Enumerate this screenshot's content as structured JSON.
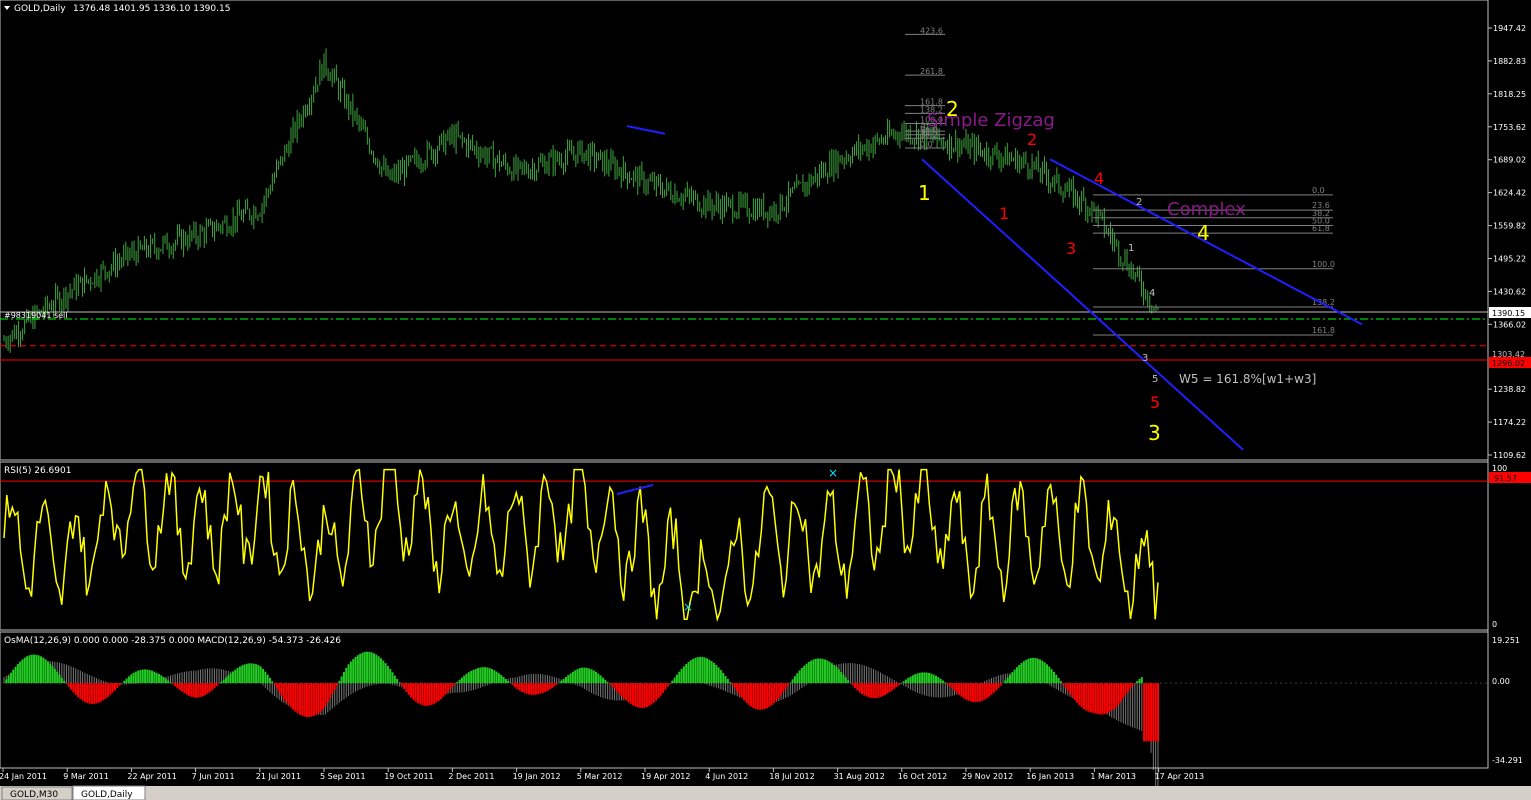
{
  "symbol_header": {
    "title": "GOLD,Daily",
    "ohlc": "1376.48 1401.95 1336.10 1390.15"
  },
  "tabs": [
    {
      "label": "GOLD,M30",
      "active": false
    },
    {
      "label": "GOLD,Daily",
      "active": true
    }
  ],
  "colors": {
    "background": "#000000",
    "price_bars": "#3fa63f",
    "rsi_line": "#ffff00",
    "osma_pos": "#22cc22",
    "osma_neg": "#ff0000",
    "macd_line": "#c8c8c8",
    "trendline": "#1f1fff",
    "fib_lines": "#808080",
    "wave_yellow": "#ffff00",
    "wave_red": "#ff0000",
    "wave_purple": "#8b1a8b"
  },
  "price_panel": {
    "y_ticks": [
      "1947.42",
      "1882.83",
      "1818.25",
      "1753.62",
      "1689.02",
      "1624.42",
      "1559.82",
      "1495.22",
      "1430.62",
      "1366.02",
      "1301.42",
      "1238.82",
      "1174.22",
      "1109.62"
    ],
    "current_price_label": "1390.15",
    "stop_level_label": "1296.02",
    "stop_level_partial_label": "1303.42",
    "order_label": "#98319041 sell"
  },
  "rsi_panel": {
    "label": "RSI(5) 26.6901",
    "y_ticks": [
      "100",
      "0"
    ],
    "level_label": "91.57"
  },
  "macd_panel": {
    "label": "OsMA(12,26,9) 0.000 0.000 -28.375 0.000  MACD(12,26,9) -54.373 -26.426",
    "y_ticks": [
      "19.251",
      "0.00",
      "-34.291"
    ]
  },
  "x_axis_labels": [
    "24 Jan 2011",
    "9 Mar 2011",
    "22 Apr 2011",
    "7 Jun 2011",
    "21 Jul 2011",
    "5 Sep 2011",
    "19 Oct 2011",
    "2 Dec 2011",
    "19 Jan 2012",
    "5 Mar 2012",
    "19 Apr 2012",
    "4 Jun 2012",
    "18 Jul 2012",
    "31 Aug 2012",
    "16 Oct 2012",
    "29 Nov 2012",
    "16 Jan 2013",
    "1 Mar 2013",
    "17 Apr 2013"
  ],
  "fib_small": [
    "423.6",
    "261.8",
    "161.8",
    "138.2",
    "100.0",
    "61.8",
    "50.0",
    "38.2",
    "0.0"
  ],
  "fib_large": [
    "0.0",
    "23.6",
    "38.2",
    "50.0",
    "61.8",
    "100.0",
    "138.2",
    "161.8"
  ],
  "wave_labels": {
    "y1": "1",
    "y2": "2",
    "y3": "3",
    "y4": "4",
    "r1": "1",
    "r2": "2",
    "r3": "3",
    "r4": "4",
    "r5": "5",
    "g1": "1",
    "g2": "2",
    "g3": "3",
    "g4": "4",
    "g5": "5",
    "simple_zigzag": "Simple Zigzag",
    "complex": "Complex",
    "w5_note": "W5 = 161.8%[w1+w3]"
  },
  "chart_data": {
    "type": "line",
    "title": "GOLD,Daily",
    "x": [
      "24 Jan 2011",
      "9 Mar 2011",
      "22 Apr 2011",
      "7 Jun 2011",
      "21 Jul 2011",
      "5 Sep 2011",
      "19 Oct 2011",
      "2 Dec 2011",
      "19 Jan 2012",
      "5 Mar 2012",
      "19 Apr 2012",
      "4 Jun 2012",
      "18 Jul 2012",
      "31 Aug 2012",
      "16 Oct 2012",
      "29 Nov 2012",
      "16 Jan 2013",
      "1 Mar 2013",
      "17 Apr 2013"
    ],
    "series": [
      {
        "name": "GOLD,Daily",
        "values": [
          1335,
          1430,
          1505,
          1540,
          1595,
          1880,
          1650,
          1735,
          1665,
          1705,
          1645,
          1600,
          1590,
          1690,
          1745,
          1715,
          1680,
          1590,
          1390
        ]
      },
      {
        "name": "RSI(5)",
        "values": [
          55,
          40,
          80,
          60,
          70,
          45,
          85,
          50,
          60,
          75,
          45,
          20,
          60,
          50,
          80,
          50,
          60,
          55,
          26.69
        ]
      },
      {
        "name": "MACD(12,26,9)",
        "values": [
          5,
          8,
          10,
          0,
          6,
          -25,
          -8,
          3,
          -5,
          2,
          -8,
          -10,
          -5,
          6,
          3,
          -4,
          -2,
          -6,
          -54.373
        ]
      }
    ],
    "ylim": [
      1109.62,
      1947.42
    ],
    "rsi_ylim": [
      0,
      100
    ],
    "rsi_level": 91.57,
    "macd_ylim": [
      -34.291,
      19.251
    ],
    "price_lines": {
      "current": 1390.15,
      "stop": 1296.02,
      "entry": 1376.48
    },
    "grid": false
  }
}
